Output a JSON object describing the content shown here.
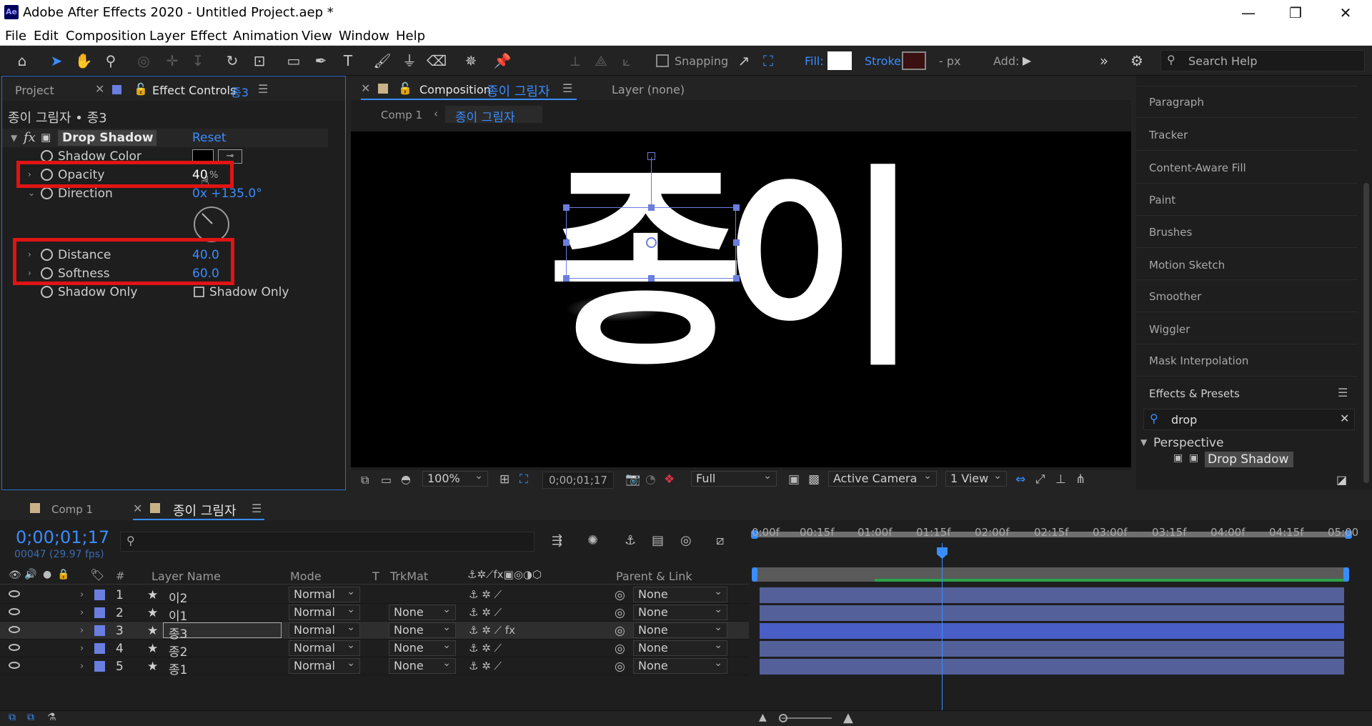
{
  "window": {
    "logo": "Ae",
    "title": "Adobe After Effects 2020 - Untitled Project.aep *",
    "minimize": "—",
    "maximize": "❐",
    "close": "✕"
  },
  "menu": [
    "File",
    "Edit",
    "Composition",
    "Layer",
    "Effect",
    "Animation",
    "View",
    "Window",
    "Help"
  ],
  "toolbar": {
    "snapping_label": "Snapping",
    "fill_label": "Fill:",
    "stroke_label": "Stroke:",
    "px_label": "- px",
    "add_label": "Add:",
    "search_placeholder": "Search Help",
    "fill_color": "#ffffff",
    "stroke_color": "#c52020"
  },
  "effect_panel": {
    "tab_project": "Project",
    "tab_effect_controls": "Effect Controls",
    "tab_effect_layer": "종3",
    "breadcrumb": "종이 그림자 • 종3",
    "effect_name": "Drop Shadow",
    "reset_label": "Reset",
    "props": {
      "shadow_color": "Shadow Color",
      "opacity": "Opacity",
      "opacity_value": "40",
      "opacity_unit": "%",
      "direction": "Direction",
      "direction_value": "0x +135.0°",
      "distance": "Distance",
      "distance_value": "40.0",
      "softness": "Softness",
      "softness_value": "60.0",
      "shadow_only": "Shadow Only",
      "shadow_only_checkbox": "Shadow Only"
    }
  },
  "composition": {
    "tab_label": "Composition",
    "tab_name": "종이 그림자",
    "layer_tab": "Layer (none)",
    "crumb_comp1": "Comp 1",
    "crumb_current": "종이 그림자",
    "canvas_text_1": "종",
    "canvas_text_2": "이",
    "zoom": "100%",
    "timecode": "0;00;01;17",
    "resolution": "Full",
    "camera": "Active Camera",
    "views": "1 View"
  },
  "right_panel": {
    "items": [
      "Paragraph",
      "Tracker",
      "Content-Aware Fill",
      "Paint",
      "Brushes",
      "Motion Sketch",
      "Smoother",
      "Wiggler",
      "Mask Interpolation",
      "Effects & Presets"
    ],
    "search_value": "drop",
    "category": "Perspective",
    "result": "Drop Shadow"
  },
  "timeline": {
    "tab_comp1": "Comp 1",
    "tab_current": "종이 그림자",
    "timecode": "0;00;01;17",
    "fps": "00047 (29.97 fps)",
    "headers": {
      "num": "#",
      "layer_name": "Layer Name",
      "mode": "Mode",
      "t": "T",
      "trkmat": "TrkMat",
      "parent": "Parent & Link"
    },
    "ticks": [
      "0:00f",
      "00:15f",
      "01:00f",
      "01:15f",
      "02:00f",
      "02:15f",
      "03:00f",
      "03:15f",
      "04:00f",
      "04:15f",
      "05:00"
    ],
    "layers": [
      {
        "num": "1",
        "name": "이2",
        "mode": "Normal",
        "trkmat": "",
        "parent": "None"
      },
      {
        "num": "2",
        "name": "이1",
        "mode": "Normal",
        "trkmat": "None",
        "parent": "None"
      },
      {
        "num": "3",
        "name": "종3",
        "mode": "Normal",
        "trkmat": "None",
        "parent": "None"
      },
      {
        "num": "4",
        "name": "종2",
        "mode": "Normal",
        "trkmat": "None",
        "parent": "None"
      },
      {
        "num": "5",
        "name": "종1",
        "mode": "Normal",
        "trkmat": "None",
        "parent": "None"
      }
    ]
  }
}
